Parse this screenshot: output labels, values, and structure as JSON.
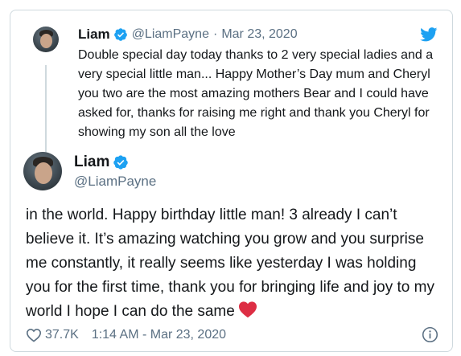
{
  "parent_tweet": {
    "name": "Liam",
    "handle": "@LiamPayne",
    "dot": "·",
    "date": "Mar 23, 2020",
    "text": "Double special day today thanks to 2 very special ladies and a very special little man... Happy Mother’s Day mum and Cheryl you two are the most amazing mothers Bear and I could have asked for, thanks for raising me right and thank you Cheryl for showing my son all the love"
  },
  "main_tweet": {
    "name": "Liam",
    "handle": "@LiamPayne",
    "text": "in the world. Happy birthday little man! 3 already I can’t believe it. It’s amazing watching you grow and you surprise me constantly, it really seems like yesterday I was holding you for the first time, thank you for bringing life and joy to my world I  hope I can do the same",
    "likes": "37.7K",
    "timestamp": "1:14 AM - Mar 23, 2020"
  },
  "icons": {
    "verified": "verified-badge-icon",
    "brand": "twitter-bird-icon",
    "like": "heart-outline-icon",
    "emoji": "red-heart-emoji-icon",
    "info": "info-icon"
  },
  "colors": {
    "brand_blue": "#1da1f2",
    "secondary_text": "#5b7083",
    "heart_red": "#e0245e",
    "border": "#cfd9de"
  }
}
